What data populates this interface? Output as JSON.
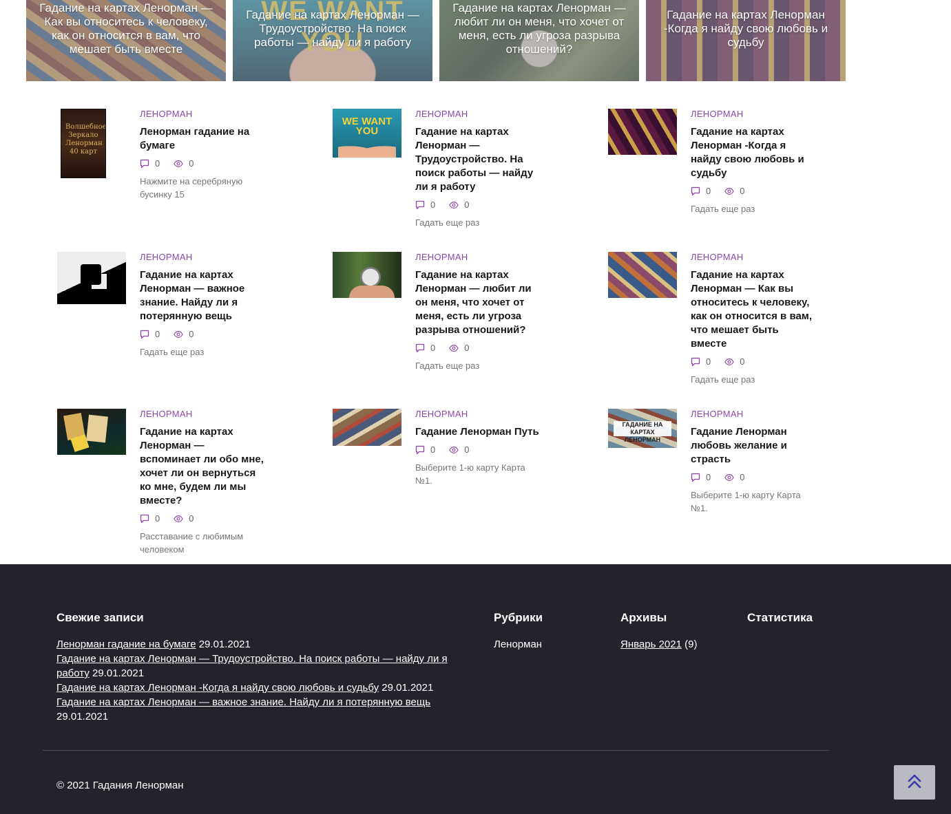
{
  "slider": [
    {
      "title": "Гадание на картах Ленорман — Как вы относитесь к человеку, как он относится в вам, что мешает быть вместе"
    },
    {
      "title": "Гадание на картах Ленорман — Трудоустройство. На поиск работы — найду ли я работу",
      "image_text": "WE WANT YOU"
    },
    {
      "title": "Гадание на картах Ленорман — любит ли он меня, что хочет от меня, есть ли угроза разрыва отношений?"
    },
    {
      "title": "Гадание на картах Ленорман -Когда я найду свою любовь и судьбу"
    }
  ],
  "posts": [
    {
      "category": "Ленорман",
      "title": "Ленорман гадание на бумаге",
      "comments": "0",
      "views": "0",
      "excerpt": "Нажмите на серебряную бусинку 15",
      "thumb_text": "Волшебное Зеркало Ленорман 40 карт"
    },
    {
      "category": "Ленорман",
      "title": "Гадание на картах Ленорман — Трудоустройство. На поиск работы — найду ли я работу",
      "comments": "0",
      "views": "0",
      "excerpt": "Гадать еще раз",
      "thumb_text": "WE WANT YOU"
    },
    {
      "category": "Ленорман",
      "title": "Гадание на картах Ленорман -Когда я найду свою любовь и судьбу",
      "comments": "0",
      "views": "0",
      "excerpt": "Гадать еще раз"
    },
    {
      "category": "Ленорман",
      "title": "Гадание на картах Ленорман — важное знание. Найду ли я потерянную вещь",
      "comments": "0",
      "views": "0",
      "excerpt": "Гадать еще раз"
    },
    {
      "category": "Ленорман",
      "title": "Гадание на картах Ленорман — любит ли он меня, что хочет от меня, есть ли угроза разрыва отношений?",
      "comments": "0",
      "views": "0",
      "excerpt": "Гадать еще раз"
    },
    {
      "category": "Ленорман",
      "title": "Гадание на картах Ленорман — Как вы относитесь к человеку, как он относится в вам, что мешает быть вместе",
      "comments": "0",
      "views": "0",
      "excerpt": "Гадать еще раз"
    },
    {
      "category": "Ленорман",
      "title": "Гадание на картах Ленорман — вспоминает ли обо мне, хочет ли он вернуться ко мне, будем ли мы вместе?",
      "comments": "0",
      "views": "0",
      "excerpt": "Расставание с любимым человеком"
    },
    {
      "category": "Ленорман",
      "title": "Гадание Ленорман Путь",
      "comments": "0",
      "views": "0",
      "excerpt": "Выберите 1-ю карту Карта №1."
    },
    {
      "category": "Ленорман",
      "title": "Гадание Ленорман любовь желание и страсть",
      "comments": "0",
      "views": "0",
      "excerpt": "Выберите 1-ю карту Карта №1.",
      "thumb_text": "ГАДАНИЕ НА КАРТАХ ЛЕНОРМАН"
    }
  ],
  "footer": {
    "recent": {
      "heading": "Свежие записи",
      "items": [
        {
          "link": "Ленорман гадание на бумаге",
          "date": " 29.01.2021"
        },
        {
          "link": "Гадание на картах Ленорман — Трудоустройство. На поиск работы — найду ли я работу",
          "date": " 29.01.2021"
        },
        {
          "link": "Гадание на картах Ленорман -Когда я найду свою любовь и судьбу",
          "date": " 29.01.2021"
        },
        {
          "link": "Гадание на картах Ленорман — важное знание. Найду ли я потерянную вещь",
          "date": " 29.01.2021"
        }
      ]
    },
    "rubrics": {
      "heading": "Рубрики",
      "items": [
        "Ленорман"
      ]
    },
    "archives": {
      "heading": "Архивы",
      "link": "Январь 2021",
      "count": " (9)"
    },
    "stats": {
      "heading": "Статистика"
    },
    "copyright": "© 2021 Гадания Ленорман"
  },
  "colors": {
    "accent": "#8e44ad",
    "footer_bg": "#24232c",
    "scroll_top_bg": "#b9b9c2"
  },
  "icons": {
    "comments": "comment-icon",
    "views": "eye-icon",
    "scroll_top": "double-chevron-up-icon"
  }
}
